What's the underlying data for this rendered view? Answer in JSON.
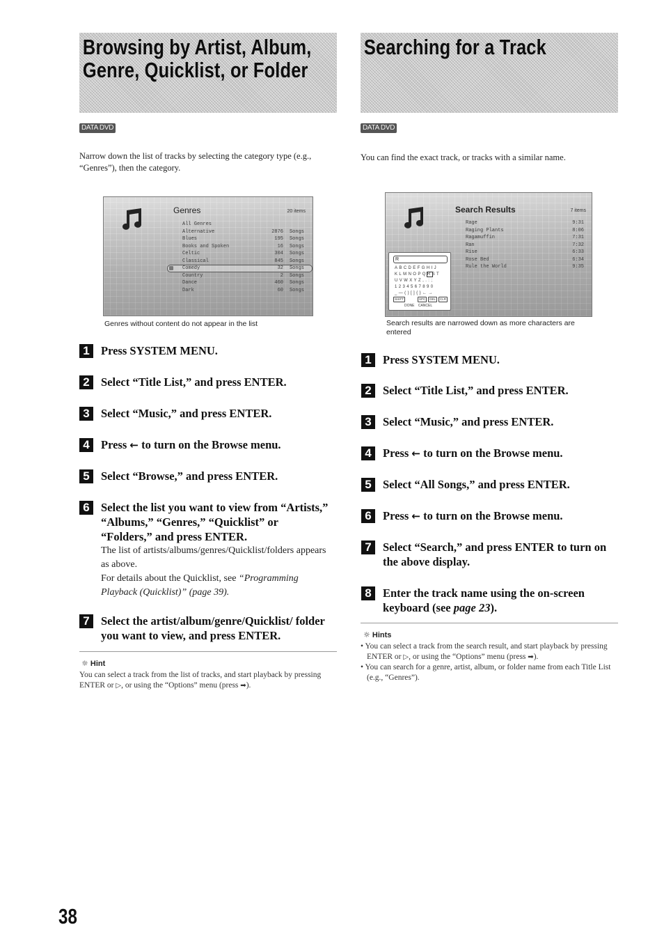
{
  "left": {
    "title_line1": "Browsing by Artist, Album,",
    "title_line2": "Genre, Quicklist, or Folder",
    "badge": "DATA DVD",
    "intro": "Narrow down the list of tracks by selecting the category type (e.g., “Genres”), then the category.",
    "screen": {
      "icon": "music-note-icon",
      "title": "Genres",
      "count": "20 items",
      "rows": [
        {
          "name": "All Genres",
          "num": "",
          "unit": ""
        },
        {
          "name": "Alternative",
          "num": "2876",
          "unit": "Songs"
        },
        {
          "name": "Blues",
          "num": "195",
          "unit": "Songs"
        },
        {
          "name": "Books and Spoken",
          "num": "16",
          "unit": "Songs"
        },
        {
          "name": "Celtic",
          "num": "304",
          "unit": "Songs"
        },
        {
          "name": "Classical",
          "num": "845",
          "unit": "Songs"
        },
        {
          "name": "Comedy",
          "num": "32",
          "unit": "Songs"
        },
        {
          "name": "Country",
          "num": "2",
          "unit": "Songs"
        },
        {
          "name": "Dance",
          "num": "460",
          "unit": "Songs"
        },
        {
          "name": "Dark",
          "num": "60",
          "unit": "Songs"
        }
      ],
      "selected_row": "Comedy"
    },
    "caption": "Genres without content do not appear in the list",
    "steps": [
      {
        "num": "1",
        "text": "Press SYSTEM MENU."
      },
      {
        "num": "2",
        "text": "Select “Title List,” and press ENTER."
      },
      {
        "num": "3",
        "text": "Select “Music,” and press ENTER."
      },
      {
        "num": "4",
        "text_before": "Press",
        "arrow": "←",
        "text_after": "to turn on the Browse menu."
      },
      {
        "num": "5",
        "text": "Select “Browse,” and press ENTER."
      },
      {
        "num": "6",
        "text": "Select the list you want to view from “Artists,” “Albums,” “Genres,” “Quicklist” or “Folders,” and press ENTER.",
        "desc1": "The list of artists/albums/genres/Quicklist/folders appears as above.",
        "desc2_before": "For details about the Quicklist, see ",
        "desc2_link": "“Programming Playback (Quicklist)” (page 39)."
      },
      {
        "num": "7",
        "text": "Select the artist/album/genre/Quicklist/ folder you want to view, and press ENTER."
      }
    ],
    "hint": {
      "icon": "lightbulb-icon",
      "title": "Hint",
      "body_before": "You can select a track from the list of tracks, and start playback by pressing ENTER or ",
      "play_symbol": "▷",
      "body_mid": ", or using the “Options” menu (press ",
      "arrow_symbol": "➡",
      "body_after": ")."
    }
  },
  "right": {
    "title": "Searching for a Track",
    "badge": "DATA DVD",
    "intro": "You can find the exact track, or tracks with a similar name.",
    "screen": {
      "icon": "music-note-icon",
      "title": "Search Results",
      "count": "7 items",
      "rows": [
        {
          "name": "Rage",
          "time": "9:31"
        },
        {
          "name": "Raging Plants",
          "time": "8:06"
        },
        {
          "name": "Ragamuffin",
          "time": "7:31"
        },
        {
          "name": "Ran",
          "time": "7:32"
        },
        {
          "name": "Rise",
          "time": "6:33"
        },
        {
          "name": "Rose Bed",
          "time": "6:34"
        },
        {
          "name": "Rule the World",
          "time": "9:35"
        }
      ],
      "keyboard": {
        "input_value": "R",
        "rows": [
          "ABCDEFGHIJ",
          "KLMNOPQRST",
          "UVWXYZ,.:;",
          "1234567890",
          "_—()[]{}←→"
        ],
        "highlighted_key": "R",
        "buttons": [
          "SHIFT",
          "SPC",
          "DEL",
          "CLR"
        ],
        "done": "DONE",
        "cancel": "CANCEL"
      }
    },
    "caption": "Search results are narrowed down as more characters are entered",
    "steps": [
      {
        "num": "1",
        "text": "Press SYSTEM MENU."
      },
      {
        "num": "2",
        "text": "Select “Title List,” and press ENTER."
      },
      {
        "num": "3",
        "text": "Select “Music,” and press ENTER."
      },
      {
        "num": "4",
        "text_before": "Press",
        "arrow": "←",
        "text_after": "to turn on the Browse menu."
      },
      {
        "num": "5",
        "text": "Select “All Songs,” and press ENTER."
      },
      {
        "num": "6",
        "text_before": "Press",
        "arrow": "←",
        "text_after": "to turn on the Browse menu."
      },
      {
        "num": "7",
        "text": "Select “Search,” and press ENTER to turn on the above display."
      },
      {
        "num": "8",
        "text_before": "Enter the track name using the on-screen keyboard (see ",
        "link": "page 23",
        "text_after": ")."
      }
    ],
    "hints": {
      "icon": "lightbulb-icon",
      "title": "Hints",
      "item1_before": "You can select a track from the search result, and start playback by pressing ENTER or ",
      "play_symbol": "▷",
      "item1_mid": ", or using the “Options” menu (press ",
      "arrow_symbol": "➡",
      "item1_after": ").",
      "item2": "You can search for a genre, artist, album, or folder name from each Title List (e.g., “Genres”)."
    }
  },
  "page_number": "38"
}
